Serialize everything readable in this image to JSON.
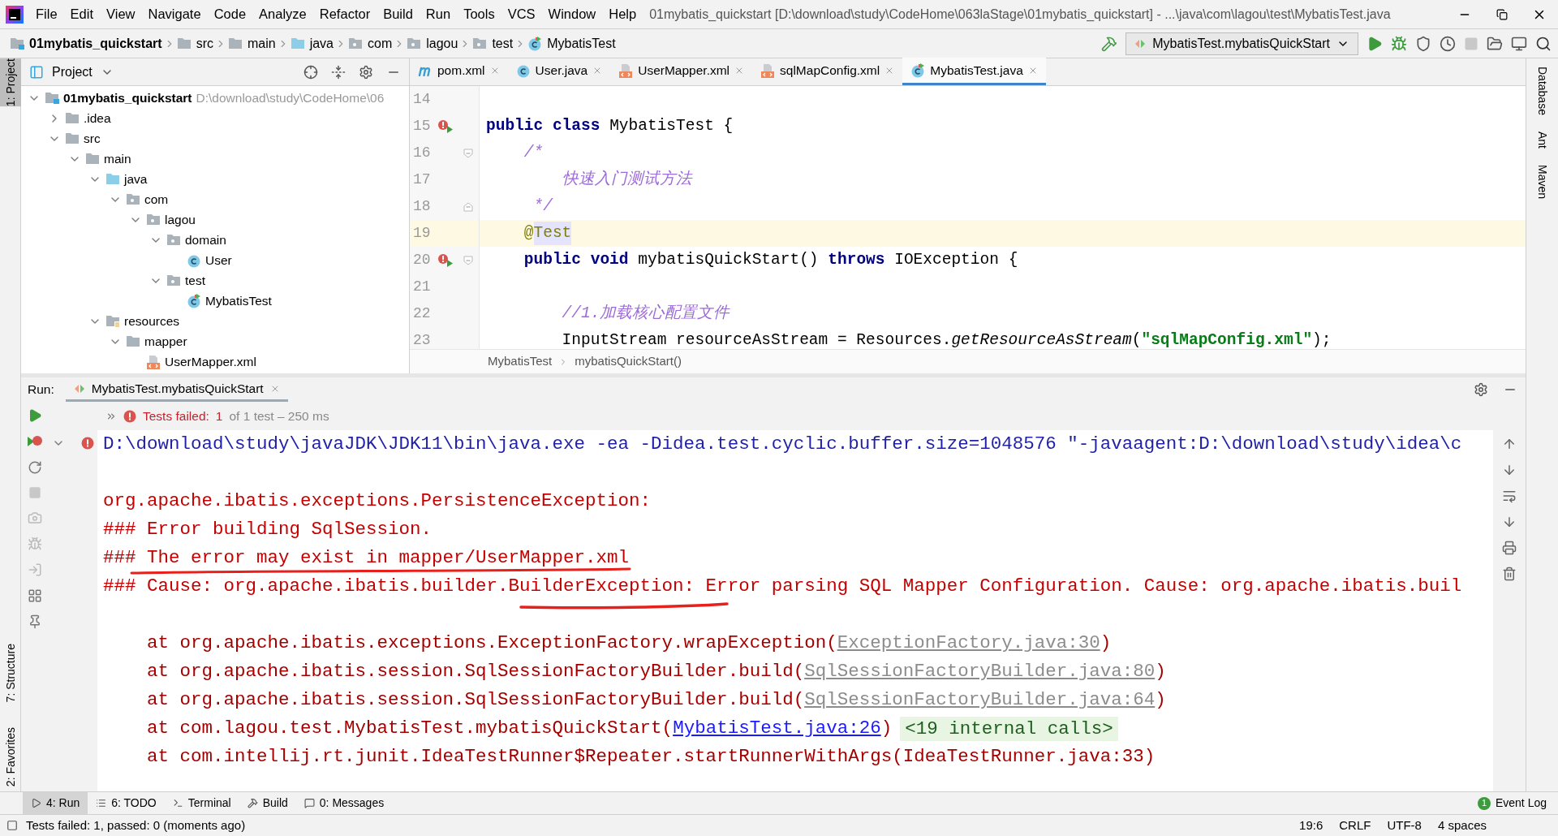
{
  "menu": [
    "File",
    "Edit",
    "View",
    "Navigate",
    "Code",
    "Analyze",
    "Refactor",
    "Build",
    "Run",
    "Tools",
    "VCS",
    "Window",
    "Help"
  ],
  "window_title": "01mybatis_quickstart [D:\\download\\study\\CodeHome\\063laStage\\01mybatis_quickstart] - ...\\java\\com\\lagou\\test\\MybatisTest.java",
  "breadcrumbs": [
    {
      "label": "01mybatis_quickstart",
      "kind": "module"
    },
    {
      "label": "src",
      "kind": "folder"
    },
    {
      "label": "main",
      "kind": "folder"
    },
    {
      "label": "java",
      "kind": "source_root"
    },
    {
      "label": "com",
      "kind": "package"
    },
    {
      "label": "lagou",
      "kind": "package"
    },
    {
      "label": "test",
      "kind": "package"
    },
    {
      "label": "MybatisTest",
      "kind": "test_class"
    }
  ],
  "run_config": "MybatisTest.mybatisQuickStart",
  "left_stripe": {
    "top": "1: Project",
    "bottom": [
      "7: Structure",
      "2: Favorites"
    ]
  },
  "right_stripe": [
    "Database",
    "Ant",
    "Maven"
  ],
  "project_panel": {
    "title": "Project",
    "tree": [
      {
        "label": "01mybatis_quickstart",
        "kind": "module",
        "path": "D:\\download\\study\\CodeHome\\06",
        "expanded": true,
        "children": [
          {
            "label": ".idea",
            "kind": "folder",
            "expanded": false
          },
          {
            "label": "src",
            "kind": "folder",
            "expanded": true,
            "children": [
              {
                "label": "main",
                "kind": "folder",
                "expanded": true,
                "children": [
                  {
                    "label": "java",
                    "kind": "source_root",
                    "expanded": true,
                    "children": [
                      {
                        "label": "com",
                        "kind": "package",
                        "expanded": true,
                        "children": [
                          {
                            "label": "lagou",
                            "kind": "package",
                            "expanded": true,
                            "children": [
                              {
                                "label": "domain",
                                "kind": "package",
                                "expanded": true,
                                "children": [
                                  {
                                    "label": "User",
                                    "kind": "class"
                                  }
                                ]
                              },
                              {
                                "label": "test",
                                "kind": "package",
                                "expanded": true,
                                "children": [
                                  {
                                    "label": "MybatisTest",
                                    "kind": "test_class"
                                  }
                                ]
                              }
                            ]
                          }
                        ]
                      }
                    ]
                  },
                  {
                    "label": "resources",
                    "kind": "resources",
                    "expanded": true,
                    "children": [
                      {
                        "label": "mapper",
                        "kind": "folder",
                        "expanded": true,
                        "children": [
                          {
                            "label": "UserMapper.xml",
                            "kind": "xml"
                          }
                        ]
                      }
                    ]
                  }
                ]
              }
            ]
          }
        ]
      }
    ]
  },
  "editor_tabs": [
    {
      "label": "pom.xml",
      "kind": "maven",
      "selected": false
    },
    {
      "label": "User.java",
      "kind": "class",
      "selected": false
    },
    {
      "label": "UserMapper.xml",
      "kind": "xml",
      "selected": false
    },
    {
      "label": "sqlMapConfig.xml",
      "kind": "xml",
      "selected": false
    },
    {
      "label": "MybatisTest.java",
      "kind": "test_class",
      "selected": true
    }
  ],
  "code_lines": [
    {
      "number": "14",
      "current": false,
      "run_marker": false,
      "fold_start": false,
      "fold_end": false
    },
    {
      "number": "15",
      "current": false,
      "run_marker": true,
      "fold_start": false,
      "fold_end": false,
      "tokens": [
        {
          "text": "public class ",
          "kind": "keyword"
        },
        {
          "text": "MybatisTest {",
          "kind": "plain"
        }
      ]
    },
    {
      "number": "16",
      "current": false,
      "run_marker": false,
      "fold_start": true,
      "fold_end": false,
      "tokens": [
        {
          "text": "    /*",
          "kind": "comment"
        }
      ]
    },
    {
      "number": "17",
      "current": false,
      "run_marker": false,
      "fold_start": false,
      "fold_end": false,
      "tokens": [
        {
          "text": "        快速入门测试方法",
          "kind": "comment"
        }
      ]
    },
    {
      "number": "18",
      "current": false,
      "run_marker": false,
      "fold_start": false,
      "fold_end": true,
      "tokens": [
        {
          "text": "     */",
          "kind": "comment"
        }
      ]
    },
    {
      "number": "19",
      "current": true,
      "run_marker": false,
      "fold_start": false,
      "fold_end": false,
      "tokens": [
        {
          "text": "    @",
          "kind": "annotation"
        },
        {
          "text": "Test",
          "kind": "annotation",
          "highlighted": true
        }
      ]
    },
    {
      "number": "20",
      "current": false,
      "run_marker": true,
      "fold_start": true,
      "fold_end": false,
      "tokens": [
        {
          "text": "    public void ",
          "kind": "keyword"
        },
        {
          "text": "mybatisQuickStart() ",
          "kind": "plain"
        },
        {
          "text": "throws ",
          "kind": "keyword"
        },
        {
          "text": "IOException {",
          "kind": "plain"
        }
      ]
    },
    {
      "number": "21",
      "current": false,
      "run_marker": false,
      "fold_start": false,
      "fold_end": false
    },
    {
      "number": "22",
      "current": false,
      "run_marker": false,
      "fold_start": false,
      "fold_end": false,
      "tokens": [
        {
          "text": "        //1.加载核心配置文件",
          "kind": "comment"
        }
      ]
    },
    {
      "number": "23",
      "current": false,
      "run_marker": false,
      "fold_start": false,
      "fold_end": false,
      "tokens": [
        {
          "text": "        InputStream resourceAsStream = Resources.",
          "kind": "plain"
        },
        {
          "text": "getResourceAsStream",
          "kind": "static_method"
        },
        {
          "text": "(",
          "kind": "plain"
        },
        {
          "text": "\"sqlMapConfig.xml\"",
          "kind": "string"
        },
        {
          "text": ");",
          "kind": "plain"
        }
      ]
    }
  ],
  "editor_breadcrumbs": [
    "MybatisTest",
    "mybatisQuickStart()"
  ],
  "run_panel": {
    "label": "Run:",
    "tab": "MybatisTest.mybatisQuickStart",
    "status": {
      "failed_label": "Tests failed:",
      "failed_count": "1",
      "rest": "of 1 test – 250 ms"
    },
    "console": [
      {
        "kind": "command",
        "text": "D:\\download\\study\\javaJDK\\JDK11\\bin\\java.exe -ea -Didea.test.cyclic.buffer.size=1048576 \"-javaagent:D:\\download\\study\\idea\\c"
      },
      {
        "kind": "blank"
      },
      {
        "kind": "error",
        "text": "org.apache.ibatis.exceptions.PersistenceException:"
      },
      {
        "kind": "error",
        "text": "### Error building SqlSession."
      },
      {
        "kind": "error",
        "text": "### The error may exist in mapper/UserMapper.xml"
      },
      {
        "kind": "error",
        "text": "### Cause: org.apache.ibatis.builder.BuilderException: Error parsing SQL Mapper Configuration. Cause: org.apache.ibatis.buil"
      },
      {
        "kind": "blank"
      },
      {
        "kind": "stack",
        "text": "    at org.apache.ibatis.exceptions.ExceptionFactory.wrapException(",
        "link": "ExceptionFactory.java:30",
        "library": true,
        "suffix": ")"
      },
      {
        "kind": "stack",
        "text": "    at org.apache.ibatis.session.SqlSessionFactoryBuilder.build(",
        "link": "SqlSessionFactoryBuilder.java:80",
        "library": true,
        "suffix": ")"
      },
      {
        "kind": "stack",
        "text": "    at org.apache.ibatis.session.SqlSessionFactoryBuilder.build(",
        "link": "SqlSessionFactoryBuilder.java:64",
        "library": true,
        "suffix": ")"
      },
      {
        "kind": "stack",
        "text": "    at com.lagou.test.MybatisTest.mybatisQuickStart(",
        "link": "MybatisTest.java:26",
        "library": false,
        "suffix": ")",
        "badge": "<19 internal calls>"
      },
      {
        "kind": "stack",
        "text": "    at com.intellij.rt.junit.IdeaTestRunner$Repeater.startRunnerWithArgs(IdeaTestRunner.java:33)"
      }
    ]
  },
  "bottom_tabs": [
    {
      "label": "4: Run",
      "kind": "run",
      "selected": true
    },
    {
      "label": "6: TODO",
      "kind": "todo",
      "selected": false
    },
    {
      "label": "Terminal",
      "kind": "terminal",
      "selected": false
    },
    {
      "label": "Build",
      "kind": "build",
      "selected": false
    },
    {
      "label": "0: Messages",
      "kind": "messages",
      "selected": false
    }
  ],
  "event_log": {
    "label": "Event Log",
    "count": "1"
  },
  "status_bar": {
    "message": "Tests failed: 1, passed: 0 (moments ago)",
    "items": [
      "19:6",
      "CRLF",
      "UTF-8",
      "4 spaces"
    ]
  }
}
